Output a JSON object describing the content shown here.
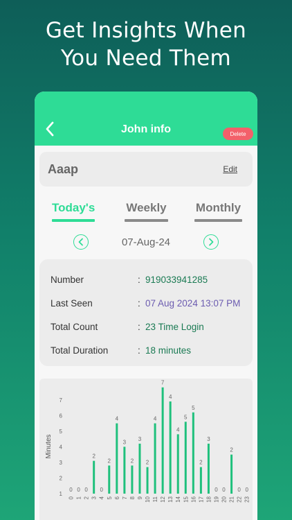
{
  "headline": {
    "line1": "Get Insights When",
    "line2": "You Need Them"
  },
  "appbar": {
    "title": "John info",
    "delete_label": "Delete",
    "back_icon": "chevron-left-icon"
  },
  "name_card": {
    "name": "Aaap",
    "edit_label": "Edit"
  },
  "tabs": [
    {
      "label": "Today's",
      "active": true
    },
    {
      "label": "Weekly",
      "active": false
    },
    {
      "label": "Monthly",
      "active": false
    }
  ],
  "date_nav": {
    "date": "07-Aug-24",
    "prev_icon": "chevron-left-circle-icon",
    "next_icon": "chevron-right-circle-icon"
  },
  "info": {
    "rows": [
      {
        "label": "Number",
        "value": "919033941285"
      },
      {
        "label": "Last Seen",
        "value": "07 Aug 2024 13:07 PM"
      },
      {
        "label": "Total Count",
        "value": "23 Time Login"
      },
      {
        "label": "Total Duration",
        "value": "18 minutes"
      }
    ],
    "separator": ":"
  },
  "colors": {
    "accent": "#2edc96",
    "value_green": "#1a7a53",
    "last_seen_purple": "#6c5cb0",
    "delete_red": "#f3606a"
  },
  "chart_data": {
    "type": "bar",
    "ylabel": "Minutes",
    "xlabel": "",
    "categories": [
      "0",
      "1",
      "2",
      "3",
      "4",
      "5",
      "6",
      "7",
      "8",
      "9",
      "10",
      "11",
      "12",
      "13",
      "14",
      "15",
      "16",
      "17",
      "18",
      "19",
      "20",
      "21",
      "22",
      "23"
    ],
    "values": [
      0,
      0,
      0,
      2,
      0,
      2,
      4,
      3,
      2,
      3,
      2,
      4,
      7,
      4,
      4,
      5,
      5,
      2,
      3,
      0,
      0,
      2,
      0,
      0
    ],
    "bar_heights": [
      0,
      0,
      0,
      2.1,
      0,
      1.8,
      4.5,
      3.0,
      1.8,
      3.2,
      1.7,
      4.5,
      6.8,
      5.9,
      3.8,
      4.6,
      5.2,
      1.7,
      3.2,
      0,
      0,
      2.5,
      0,
      0
    ],
    "data_labels": [
      "0",
      "0",
      "0",
      "2",
      "0",
      "2",
      "4",
      "3",
      "2",
      "3",
      "2",
      "4",
      "7",
      "4",
      "4",
      "5",
      "5",
      "2",
      "3",
      "0",
      "0",
      "2",
      "0",
      "0"
    ],
    "yticks": [
      "1",
      "2",
      "3",
      "4",
      "5",
      "6",
      "7"
    ],
    "ylim": [
      1,
      7.3
    ],
    "grid": false,
    "bar_color": "#1fc07c"
  }
}
